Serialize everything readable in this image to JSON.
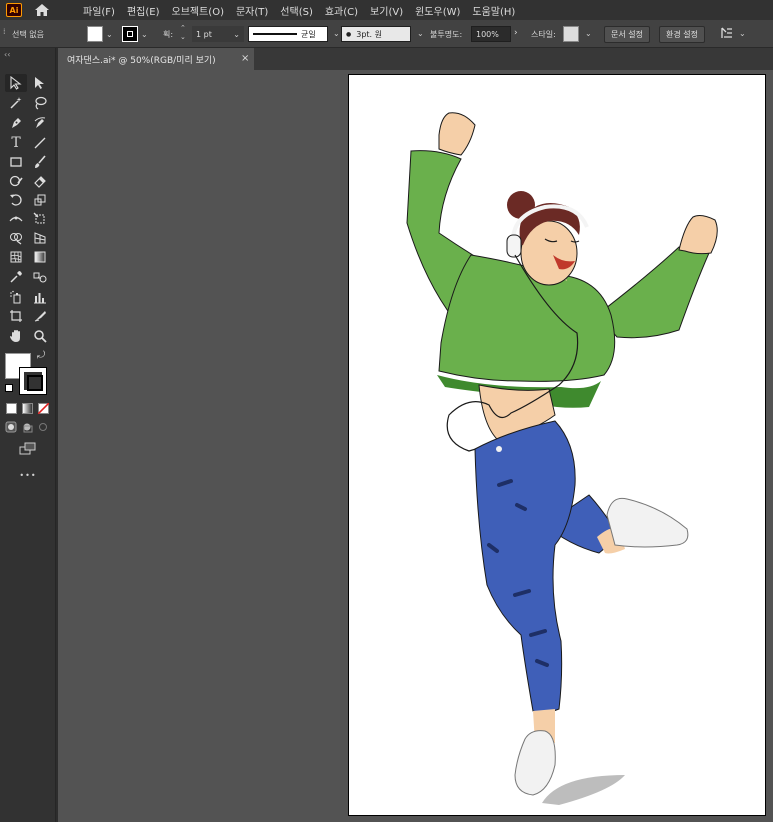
{
  "app": {
    "logo_text": "Ai",
    "accent": "#ff9a00"
  },
  "menu": {
    "items": [
      "파일(F)",
      "편집(E)",
      "오브젝트(O)",
      "문자(T)",
      "선택(S)",
      "효과(C)",
      "보기(V)",
      "윈도우(W)",
      "도움말(H)"
    ]
  },
  "control_bar": {
    "selection_label": "선택 없음",
    "stroke_label": "획:",
    "stroke_weight": "1 pt",
    "stroke_profile": "균일",
    "brush_value": "3pt. 원",
    "opacity_label": "불투명도:",
    "opacity_value": "100%",
    "style_label": "스타일:",
    "doc_setup_button": "문서 설정",
    "preferences_button": "환경 설정"
  },
  "document_tab": {
    "title": "여자댄스.ai* @ 50%(RGB/미리 보기)",
    "close_glyph": "×"
  },
  "toolbar": {
    "grip": "‹‹",
    "more_glyph": "•••",
    "fill_color": "#ffffff",
    "stroke_color": "#000000"
  },
  "artwork": {
    "sweater_color": "#6ab04c",
    "jeans_color": "#3f5fb8",
    "skin_color": "#f5cfa8",
    "hair_color": "#6b2a25",
    "shoe_color": "#f2f2f2",
    "shadow_color": "#bdbdbd"
  }
}
